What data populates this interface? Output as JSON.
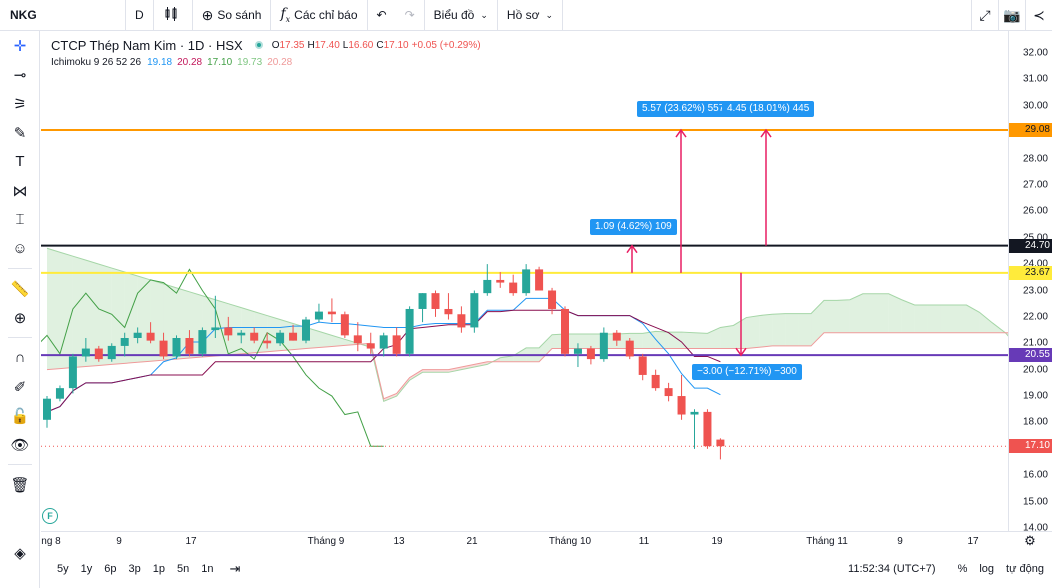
{
  "toolbar": {
    "symbol": "NKG",
    "interval": "D",
    "compare_label": "So sánh",
    "indicators_label": "Các chỉ báo",
    "chart_type_label": "Biểu đồ",
    "profile_label": "Hồ sơ"
  },
  "legend": {
    "title": "CTCP Thép Nam Kim · 1D · HSX",
    "open_key": "O",
    "open": "17.35",
    "high_key": "H",
    "high": "17.40",
    "low_key": "L",
    "low": "16.60",
    "close_key": "C",
    "close": "17.10",
    "change": "+0.05 (+0.29%)",
    "indicator_name": "Ichimoku 9 26 52 26",
    "ind_v1": "19.18",
    "ind_v2": "20.28",
    "ind_v3": "17.10",
    "ind_v4": "19.73",
    "ind_v5": "20.28"
  },
  "colors": {
    "up": "#26a69a",
    "down": "#ef5350",
    "line_orange": "#ff9800",
    "line_black": "#131722",
    "line_yellow": "#ffeb3b",
    "line_purple": "#673ab7",
    "tenkan": "#2196f3",
    "kijun": "#880e4f",
    "chikou": "#43a047",
    "cloud_green": "#a5d6a7",
    "cloud_red": "#ef9a9a",
    "measure": "#2196f3",
    "measure_arrow": "#e91e63"
  },
  "price_axis": {
    "labels": [
      "32.00",
      "31.00",
      "30.00",
      "29.00",
      "28.00",
      "27.00",
      "26.00",
      "25.00",
      "24.00",
      "23.00",
      "22.00",
      "21.00",
      "20.00",
      "19.00",
      "18.00",
      "17.00",
      "16.00",
      "15.00",
      "14.00"
    ],
    "tags": [
      {
        "value": "29.08",
        "price": 29.08,
        "bg": "#ff9800",
        "fg": "#131722"
      },
      {
        "value": "24.70",
        "price": 24.7,
        "bg": "#131722",
        "fg": "#ffffff"
      },
      {
        "value": "23.67",
        "price": 23.67,
        "bg": "#ffeb3b",
        "fg": "#131722"
      },
      {
        "value": "20.55",
        "price": 20.55,
        "bg": "#673ab7",
        "fg": "#ffffff"
      },
      {
        "value": "17.10",
        "price": 17.1,
        "bg": "#ef5350",
        "fg": "#ffffff"
      }
    ]
  },
  "time_axis": {
    "labels": [
      "ng 8",
      "9",
      "17",
      "Tháng 9",
      "13",
      "21",
      "Tháng 10",
      "11",
      "19",
      "Tháng 11",
      "9",
      "17"
    ]
  },
  "measures": [
    {
      "text": "5.57 (23.62%) 557"
    },
    {
      "text": "4.45 (18.01%) 445"
    },
    {
      "text": "1.09 (4.62%) 109"
    },
    {
      "text": "−3.00 (−12.71%) −300"
    }
  ],
  "bottom": {
    "ranges": [
      "5y",
      "1y",
      "6p",
      "3p",
      "1p",
      "5n",
      "1n"
    ],
    "clock": "11:52:34 (UTC+7)",
    "percent": "%",
    "log": "log",
    "auto": "tự động"
  },
  "chart_data": {
    "type": "candlestick",
    "ylim": [
      14,
      32.5
    ],
    "candles": [
      [
        18.1,
        19.0,
        17.8,
        18.9
      ],
      [
        18.9,
        19.4,
        18.8,
        19.3
      ],
      [
        19.3,
        20.6,
        19.1,
        20.5
      ],
      [
        20.5,
        21.2,
        20.3,
        20.8
      ],
      [
        20.8,
        20.9,
        20.3,
        20.4
      ],
      [
        20.4,
        21.0,
        20.3,
        20.9
      ],
      [
        20.9,
        21.4,
        20.5,
        21.2
      ],
      [
        21.2,
        21.6,
        21.0,
        21.4
      ],
      [
        21.4,
        21.8,
        21.0,
        21.1
      ],
      [
        21.1,
        21.4,
        20.4,
        20.5
      ],
      [
        20.5,
        21.3,
        20.4,
        21.2
      ],
      [
        21.2,
        21.5,
        20.5,
        20.6
      ],
      [
        20.6,
        21.6,
        20.5,
        21.5
      ],
      [
        21.5,
        22.8,
        21.2,
        21.6
      ],
      [
        21.6,
        22.0,
        21.1,
        21.3
      ],
      [
        21.3,
        21.5,
        21.0,
        21.4
      ],
      [
        21.4,
        21.6,
        21.0,
        21.1
      ],
      [
        21.1,
        21.4,
        20.8,
        21.0
      ],
      [
        21.0,
        21.5,
        20.9,
        21.4
      ],
      [
        21.4,
        21.7,
        21.1,
        21.1
      ],
      [
        21.1,
        22.0,
        21.0,
        21.9
      ],
      [
        21.9,
        22.5,
        21.8,
        22.2
      ],
      [
        22.2,
        22.7,
        21.8,
        22.1
      ],
      [
        22.1,
        22.2,
        21.2,
        21.3
      ],
      [
        21.3,
        21.8,
        20.7,
        21.0
      ],
      [
        21.0,
        21.4,
        20.6,
        20.8
      ],
      [
        20.8,
        21.4,
        20.5,
        21.3
      ],
      [
        21.3,
        21.6,
        20.5,
        20.6
      ],
      [
        20.6,
        22.4,
        20.5,
        22.3
      ],
      [
        22.3,
        22.9,
        21.8,
        22.9
      ],
      [
        22.9,
        23.0,
        22.0,
        22.3
      ],
      [
        22.3,
        22.9,
        21.9,
        22.1
      ],
      [
        22.1,
        22.4,
        21.4,
        21.6
      ],
      [
        21.6,
        23.0,
        21.4,
        22.9
      ],
      [
        22.9,
        24.0,
        22.8,
        23.4
      ],
      [
        23.4,
        23.7,
        23.1,
        23.3
      ],
      [
        23.3,
        23.6,
        22.8,
        22.9
      ],
      [
        22.9,
        24.0,
        22.8,
        23.8
      ],
      [
        23.8,
        23.9,
        23.0,
        23.0
      ],
      [
        23.0,
        23.1,
        22.1,
        22.3
      ],
      [
        22.3,
        22.4,
        20.5,
        20.6
      ],
      [
        20.6,
        21.0,
        20.1,
        20.8
      ],
      [
        20.8,
        20.9,
        20.2,
        20.4
      ],
      [
        20.4,
        21.6,
        20.3,
        21.4
      ],
      [
        21.4,
        21.5,
        20.9,
        21.1
      ],
      [
        21.1,
        21.2,
        20.4,
        20.5
      ],
      [
        20.5,
        20.6,
        19.6,
        19.8
      ],
      [
        19.8,
        20.0,
        19.2,
        19.3
      ],
      [
        19.3,
        19.5,
        18.8,
        19.0
      ],
      [
        19.0,
        19.8,
        18.1,
        18.3
      ],
      [
        18.3,
        18.5,
        17.0,
        18.4
      ],
      [
        18.4,
        18.5,
        17.0,
        17.1
      ],
      [
        17.35,
        17.4,
        16.6,
        17.1
      ]
    ]
  }
}
